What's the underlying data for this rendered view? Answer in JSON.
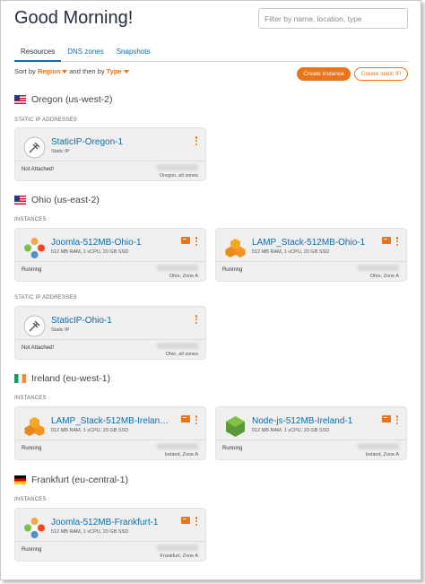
{
  "header": {
    "greeting": "Good Morning!",
    "search_placeholder": "Filter by name, location, type"
  },
  "tabs": [
    {
      "label": "Resources",
      "active": true
    },
    {
      "label": "DNS zones",
      "active": false
    },
    {
      "label": "Snapshots",
      "active": false
    }
  ],
  "sort": {
    "prefix": "Sort by",
    "primary": "Region",
    "middle": "and then by",
    "secondary": "Type"
  },
  "actions": {
    "create_instance": "Create instance",
    "create_static_ip": "Create static IP"
  },
  "colors": {
    "accent": "#e8741b",
    "link": "#0f6ca6",
    "card_bg": "#efefef"
  },
  "regions": [
    {
      "name": "Oregon (us-west-2)",
      "flag": "us",
      "sections": [
        {
          "label": "STATIC IP ADDRESSES",
          "cards": [
            {
              "kind": "static-ip",
              "icon": "pin-icon",
              "title": "StaticIP-Oregon-1",
              "subtitle": "Static IP",
              "status": "Not Attached!",
              "zone": "Oregon, all zones"
            }
          ]
        }
      ]
    },
    {
      "name": "Ohio (us-east-2)",
      "flag": "us",
      "sections": [
        {
          "label": "INSTANCES",
          "cards": [
            {
              "kind": "instance",
              "icon": "joomla-icon",
              "title": "Joomla-512MB-Ohio-1",
              "subtitle": "512 MB RAM, 1 vCPU, 20 GB SSD",
              "status": "Running",
              "zone": "Ohio, Zone A"
            },
            {
              "kind": "instance",
              "icon": "lamp-stack-icon",
              "title": "LAMP_Stack-512MB-Ohio-1",
              "subtitle": "512 MB RAM, 1 vCPU, 20 GB SSD",
              "status": "Running",
              "zone": "Ohio, Zone A"
            }
          ]
        },
        {
          "label": "STATIC IP ADDRESSES",
          "cards": [
            {
              "kind": "static-ip",
              "icon": "pin-icon",
              "title": "StaticIP-Ohio-1",
              "subtitle": "Static IP",
              "status": "Not Attached!",
              "zone": "Ohio, all zones"
            }
          ]
        }
      ]
    },
    {
      "name": "Ireland (eu-west-1)",
      "flag": "ie",
      "sections": [
        {
          "label": "INSTANCES",
          "cards": [
            {
              "kind": "instance",
              "icon": "lamp-stack-icon",
              "title": "LAMP_Stack-512MB-Irelan…",
              "subtitle": "512 MB RAM, 1 vCPU, 20 GB SSD",
              "status": "Running",
              "zone": "Ireland, Zone A"
            },
            {
              "kind": "instance",
              "icon": "nodejs-icon",
              "title": "Node-js-512MB-Ireland-1",
              "subtitle": "512 MB RAM, 1 vCPU, 20 GB SSD",
              "status": "Running",
              "zone": "Ireland, Zone A"
            }
          ]
        }
      ]
    },
    {
      "name": "Frankfurt (eu-central-1)",
      "flag": "de",
      "sections": [
        {
          "label": "INSTANCES",
          "cards": [
            {
              "kind": "instance",
              "icon": "joomla-icon",
              "title": "Joomla-512MB-Frankfurt-1",
              "subtitle": "512 MB RAM, 1 vCPU, 20 GB SSD",
              "status": "Running",
              "zone": "Frankfurt, Zone A"
            }
          ]
        }
      ]
    }
  ]
}
